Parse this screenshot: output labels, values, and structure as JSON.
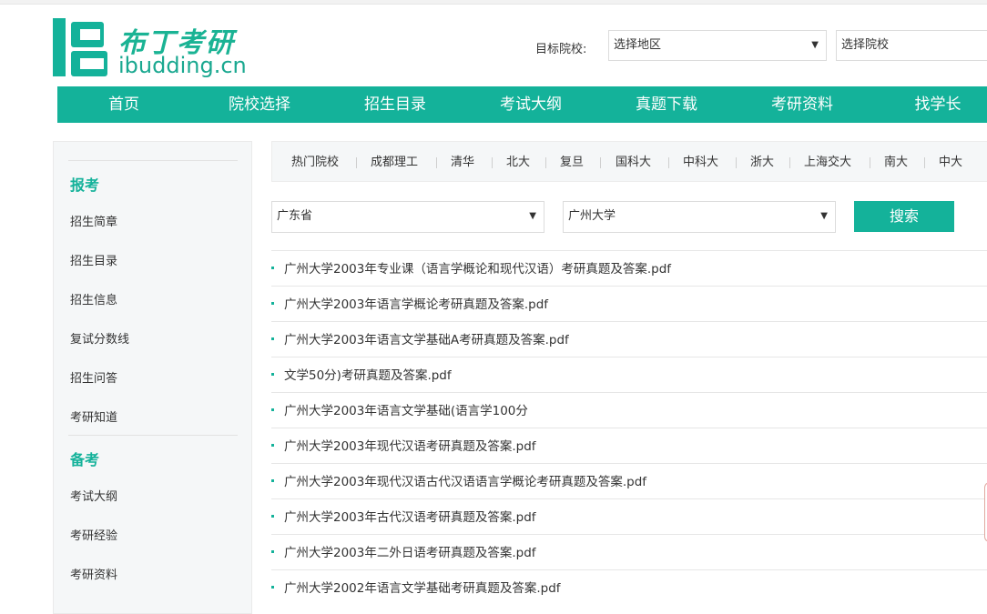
{
  "brand": {
    "name_cn": "布丁考研",
    "name_en": "ibudding.cn",
    "accent": "#14b29a"
  },
  "target": {
    "label": "目标院校:",
    "region_placeholder": "选择地区",
    "school_placeholder": "选择院校"
  },
  "nav": [
    "首页",
    "院校选择",
    "招生目录",
    "考试大纲",
    "真题下载",
    "考研资料",
    "找学长"
  ],
  "sidebar": {
    "section1": {
      "title": "报考",
      "items": [
        "招生简章",
        "招生目录",
        "招生信息",
        "复试分数线",
        "招生问答",
        "考研知道"
      ]
    },
    "section2": {
      "title": "备考",
      "items": [
        "考试大纲",
        "考研经验",
        "考研资料"
      ]
    }
  },
  "hot_schools": [
    "热门院校",
    "成都理工",
    "清华",
    "北大",
    "复旦",
    "国科大",
    "中科大",
    "浙大",
    "上海交大",
    "南大",
    "中大"
  ],
  "filter": {
    "province": "广东省",
    "university": "广州大学",
    "search_label": "搜索"
  },
  "results": [
    "广州大学2003年专业课（语言学概论和现代汉语）考研真题及答案.pdf",
    "广州大学2003年语言学概论考研真题及答案.pdf",
    "广州大学2003年语言文学基础A考研真题及答案.pdf",
    "文学50分)考研真题及答案.pdf",
    "广州大学2003年语言文学基础(语言学100分",
    "广州大学2003年现代汉语考研真题及答案.pdf",
    "广州大学2003年现代汉语古代汉语语言学概论考研真题及答案.pdf",
    "广州大学2003年古代汉语考研真题及答案.pdf",
    "广州大学2003年二外日语考研真题及答案.pdf",
    "广州大学2002年语言文学基础考研真题及答案.pdf"
  ]
}
